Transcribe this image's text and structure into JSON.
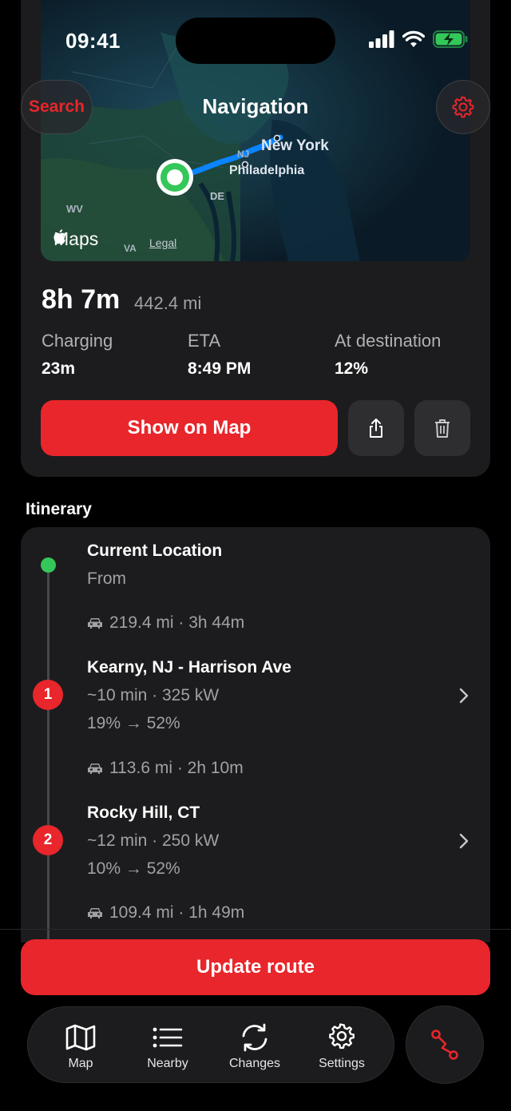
{
  "status_bar": {
    "time": "09:41"
  },
  "header": {
    "search_label": "Search",
    "title": "Navigation"
  },
  "map": {
    "labels": {
      "new_york": "New York",
      "philadelphia": "Philadelphia",
      "nj": "NJ",
      "de": "DE",
      "wv": "WV",
      "va": "VA"
    },
    "attribution": "Maps",
    "legal": "Legal"
  },
  "trip": {
    "duration": "8h 7m",
    "distance": "442.4 mi",
    "stats": [
      {
        "label": "Charging",
        "value": "23m"
      },
      {
        "label": "ETA",
        "value": "8:49 PM"
      },
      {
        "label": "At destination",
        "value": "12%"
      }
    ],
    "show_on_map_label": "Show on Map"
  },
  "itinerary": {
    "title": "Itinerary",
    "start": {
      "title": "Current Location",
      "subtitle": "From"
    },
    "legs": [
      "219.4 mi · 3h 44m",
      "113.6 mi · 2h 10m",
      "109.4 mi · 1h 49m"
    ],
    "stops": [
      {
        "number": "1",
        "title": "Kearny, NJ - Harrison Ave",
        "charge_info": "~10 min · 325 kW",
        "battery": "19% → 52%"
      },
      {
        "number": "2",
        "title": "Rocky Hill, CT",
        "charge_info": "~12 min · 250 kW",
        "battery": "10% → 52%"
      }
    ]
  },
  "update_route_label": "Update route",
  "tabs": [
    {
      "label": "Map",
      "icon": "map-icon"
    },
    {
      "label": "Nearby",
      "icon": "list-icon"
    },
    {
      "label": "Changes",
      "icon": "refresh-icon"
    },
    {
      "label": "Settings",
      "icon": "gear-icon"
    }
  ],
  "colors": {
    "accent": "#e8262b",
    "start_dot": "#34c759",
    "card": "#1c1c1e"
  }
}
